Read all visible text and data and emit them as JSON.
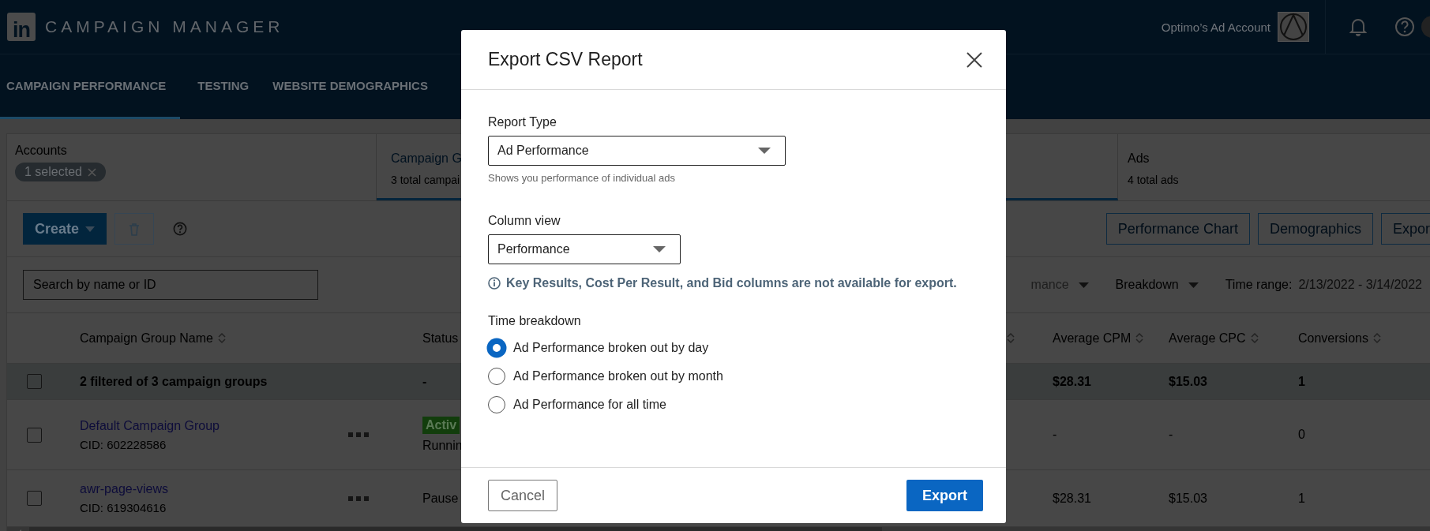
{
  "app": {
    "logo": "in",
    "title": "CAMPAIGN MANAGER",
    "account": "Optimo’s Ad Account"
  },
  "nav_tabs": [
    {
      "label": "CAMPAIGN PERFORMANCE",
      "selected": true
    },
    {
      "label": "TESTING",
      "selected": false
    },
    {
      "label": "WEBSITE DEMOGRAPHICS",
      "selected": false
    }
  ],
  "entity_tabs": [
    {
      "title": "Accounts",
      "chip": "1 selected",
      "selected": false
    },
    {
      "title": "Campaign G",
      "subtitle": "3 total campai",
      "selected": true
    },
    {
      "title": "Ads",
      "subtitle": "4 total ads",
      "selected": false
    }
  ],
  "toolbar": {
    "create": "Create",
    "right_buttons": [
      "Performance Chart",
      "Demographics",
      "Expor"
    ]
  },
  "search": {
    "placeholder": "Search by name or ID"
  },
  "filters": [
    {
      "label": "mance"
    },
    {
      "label": "Breakdown"
    }
  ],
  "time_range": {
    "label": "Time range:",
    "value": "2/13/2022 - 3/14/2022"
  },
  "table": {
    "left_columns": [
      {
        "label": "Campaign Group Name",
        "sortable": true
      },
      {
        "label": "Status",
        "sortable": false
      }
    ],
    "right_columns": [
      {
        "sortable": true
      },
      {
        "label": "Average CPM",
        "sortable": true
      },
      {
        "label": "Average CPC",
        "sortable": true
      },
      {
        "label": "Conversions",
        "sortable": true
      }
    ],
    "rows": [
      {
        "kind": "summary",
        "checked": false,
        "name": "2 filtered of 3 campaign groups",
        "status": "-",
        "cpm": "$28.31",
        "cpc": "$15.03",
        "conversions": "1"
      },
      {
        "kind": "group",
        "checked": false,
        "name": "Default Campaign Group",
        "cid": "CID: 602228586",
        "badge": "Activ",
        "status": "Runnin",
        "cpm": "-",
        "cpc": "-",
        "conversions": "0"
      },
      {
        "kind": "group",
        "checked": false,
        "name": "awr-page-views",
        "cid": "CID: 619304616",
        "status": "Pause",
        "cpm": "$28.31",
        "cpc": "$15.03",
        "conversions": "1"
      }
    ]
  },
  "modal": {
    "title": "Export CSV Report",
    "report_type": {
      "label": "Report Type",
      "value": "Ad Performance",
      "hint": "Shows you performance of individual ads"
    },
    "column_view": {
      "label": "Column view",
      "value": "Performance",
      "note": "Key Results, Cost Per Result, and Bid columns are not available for export."
    },
    "time_breakdown": {
      "label": "Time breakdown",
      "options": [
        {
          "label": "Ad Performance broken out by day",
          "selected": true
        },
        {
          "label": "Ad Performance broken out by month",
          "selected": false
        },
        {
          "label": "Ad Performance for all time",
          "selected": false
        }
      ]
    },
    "cancel": "Cancel",
    "export": "Export"
  }
}
